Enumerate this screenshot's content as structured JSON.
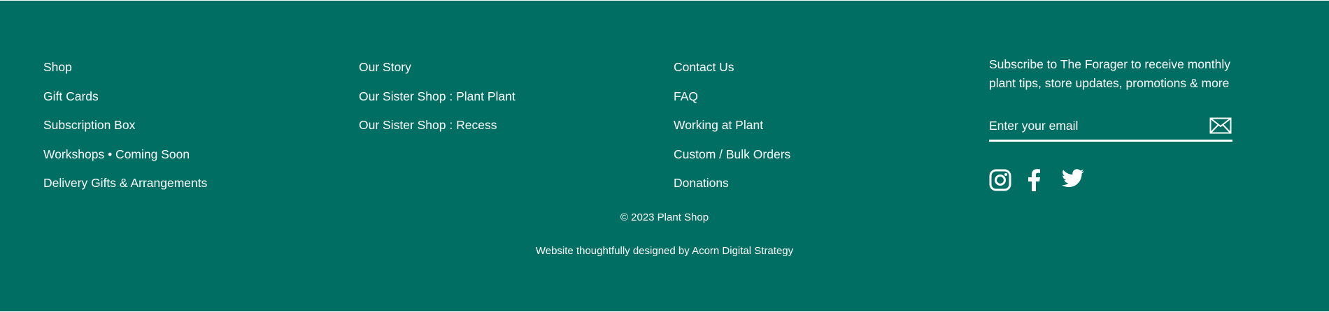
{
  "footer": {
    "colors": {
      "background": "#006e62",
      "text": "#ffffff"
    },
    "column1": [
      {
        "label": "Shop"
      },
      {
        "label": "Gift Cards"
      },
      {
        "label": "Subscription Box"
      },
      {
        "label": "Workshops • Coming Soon"
      },
      {
        "label": "Delivery Gifts & Arrangements"
      }
    ],
    "column2": [
      {
        "label": "Our Story"
      },
      {
        "label": "Our Sister Shop : Plant Plant"
      },
      {
        "label": "Our Sister Shop : Recess"
      }
    ],
    "column3": [
      {
        "label": "Contact Us"
      },
      {
        "label": "FAQ"
      },
      {
        "label": "Working at Plant"
      },
      {
        "label": "Custom / Bulk Orders"
      },
      {
        "label": "Donations"
      }
    ],
    "subscribe": {
      "text": "Subscribe to The Forager to receive monthly plant tips, store updates, promotions & more",
      "email_placeholder": "Enter your email",
      "submit_icon": "envelope-icon"
    },
    "social": [
      {
        "icon": "instagram-icon"
      },
      {
        "icon": "facebook-icon"
      },
      {
        "icon": "twitter-icon"
      }
    ],
    "copyright": "© 2023 Plant Shop",
    "credit": "Website thoughtfully designed by Acorn Digital Strategy"
  }
}
